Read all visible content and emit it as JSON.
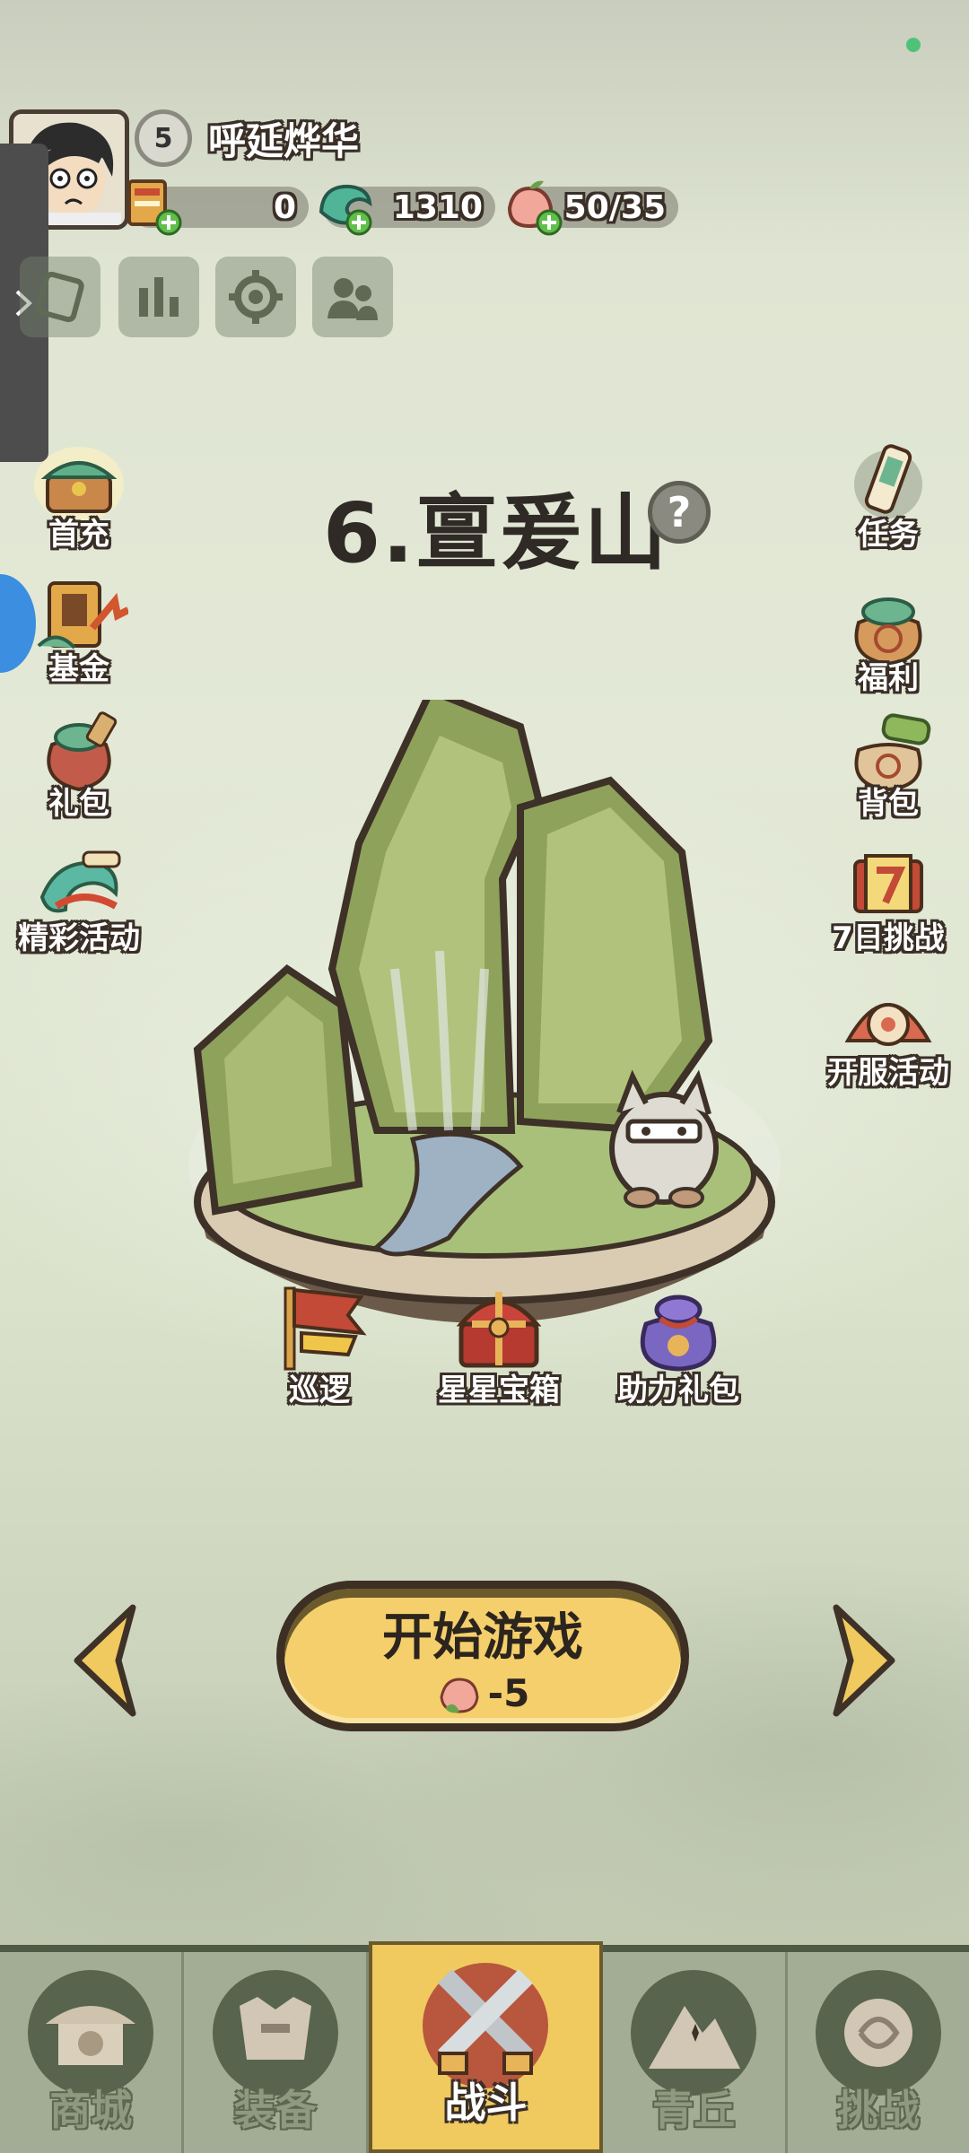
{
  "player": {
    "name": "呼延烨华",
    "level": "5"
  },
  "resources": [
    {
      "id": "scroll",
      "value": "0"
    },
    {
      "id": "jade",
      "value": "1310"
    },
    {
      "id": "peach",
      "value": "50/35"
    }
  ],
  "level": {
    "title": "6.亶爰山",
    "help": "?"
  },
  "left_icons": [
    {
      "label": "首充"
    },
    {
      "label": "基金"
    },
    {
      "label": "礼包"
    },
    {
      "label": "精彩活动"
    }
  ],
  "right_icons": [
    {
      "label": "任务"
    },
    {
      "label": "福利"
    },
    {
      "label": "背包"
    },
    {
      "label": "7日挑战"
    },
    {
      "label": "开服活动"
    }
  ],
  "rewards": [
    {
      "label": "巡逻"
    },
    {
      "label": "星星宝箱"
    },
    {
      "label": "助力礼包"
    }
  ],
  "start": {
    "label": "开始游戏",
    "cost": "-5"
  },
  "nav": [
    {
      "label": "商城"
    },
    {
      "label": "装备"
    },
    {
      "label": "战斗",
      "active": true
    },
    {
      "label": "青丘"
    },
    {
      "label": "挑战"
    }
  ],
  "colors": {
    "accent": "#f0c95f",
    "outline": "#3a2f27",
    "green_dot": "#4fc27a"
  }
}
